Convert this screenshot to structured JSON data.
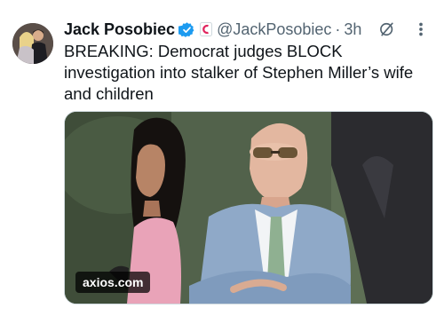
{
  "tweet": {
    "author_name": "Jack Posobiec",
    "handle": "@JackPosobiec",
    "separator": "·",
    "timestamp": "3h",
    "text": "BREAKING: Democrat judges BLOCK investigation into stalker of Stephen Miller’s wife and children",
    "media": {
      "source_label": "axios.com"
    }
  },
  "icons": {
    "verified": "verified-badge-icon",
    "affiliation": "affiliation-badge-icon",
    "grok": "grok-icon",
    "more": "more-options-icon"
  },
  "colors": {
    "verified_blue": "#1d9bf0",
    "secondary_text": "#536471",
    "primary_text": "#0f1419"
  }
}
